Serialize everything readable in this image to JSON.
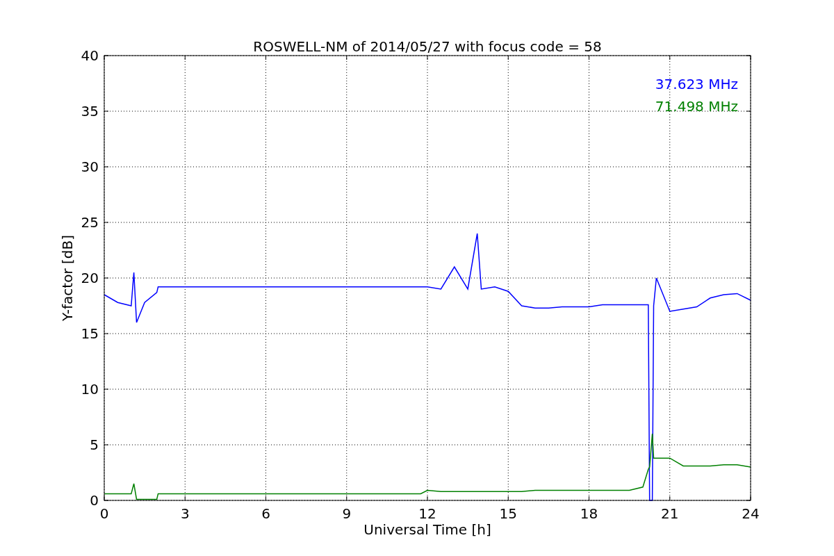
{
  "chart_data": {
    "type": "line",
    "title": "ROSWELL-NM of 2014/05/27 with focus code = 58",
    "xlabel": "Universal Time [h]",
    "ylabel": "Y-factor [dB]",
    "x": [
      0,
      0.5,
      1,
      1.1,
      1.2,
      1.5,
      1.95,
      2,
      11.75,
      12,
      12.5,
      13,
      13.5,
      13.85,
      14,
      14.5,
      15,
      15.5,
      16,
      16.5,
      17,
      17.5,
      18,
      18.5,
      19,
      19.5,
      20,
      20.2,
      20.25,
      20.35,
      20.4,
      20.5,
      21,
      21.5,
      22,
      22.5,
      23,
      23.5,
      24
    ],
    "series": [
      {
        "name": "37.623 MHz",
        "color": "#0000ff",
        "values": [
          18.5,
          17.8,
          17.5,
          20.5,
          16,
          17.8,
          18.7,
          19.2,
          19.2,
          19.2,
          19,
          21,
          19,
          24,
          19,
          19.2,
          18.8,
          17.5,
          17.3,
          17.3,
          17.4,
          17.4,
          17.4,
          17.6,
          17.6,
          17.6,
          17.6,
          17.6,
          0,
          0,
          17.5,
          20,
          17,
          17.2,
          17.4,
          18.2,
          18.5,
          18.6,
          18
        ]
      },
      {
        "name": "71.498 MHz",
        "color": "#008000",
        "values": [
          0.6,
          0.6,
          0.6,
          1.5,
          0.1,
          0.1,
          0.1,
          0.6,
          0.6,
          0.9,
          0.8,
          0.8,
          0.8,
          0.8,
          0.8,
          0.8,
          0.8,
          0.8,
          0.9,
          0.9,
          0.9,
          0.9,
          0.9,
          0.9,
          0.9,
          0.9,
          1.2,
          2.8,
          3.0,
          6,
          3.8,
          3.8,
          3.8,
          3.1,
          3.1,
          3.1,
          3.2,
          3.2,
          3.0
        ]
      }
    ],
    "grid": true,
    "xlim": [
      0,
      24
    ],
    "ylim": [
      0,
      40
    ],
    "xticks": [
      0,
      3,
      6,
      9,
      12,
      15,
      18,
      21,
      24
    ],
    "yticks": [
      0,
      5,
      10,
      15,
      20,
      25,
      30,
      35,
      40
    ]
  }
}
